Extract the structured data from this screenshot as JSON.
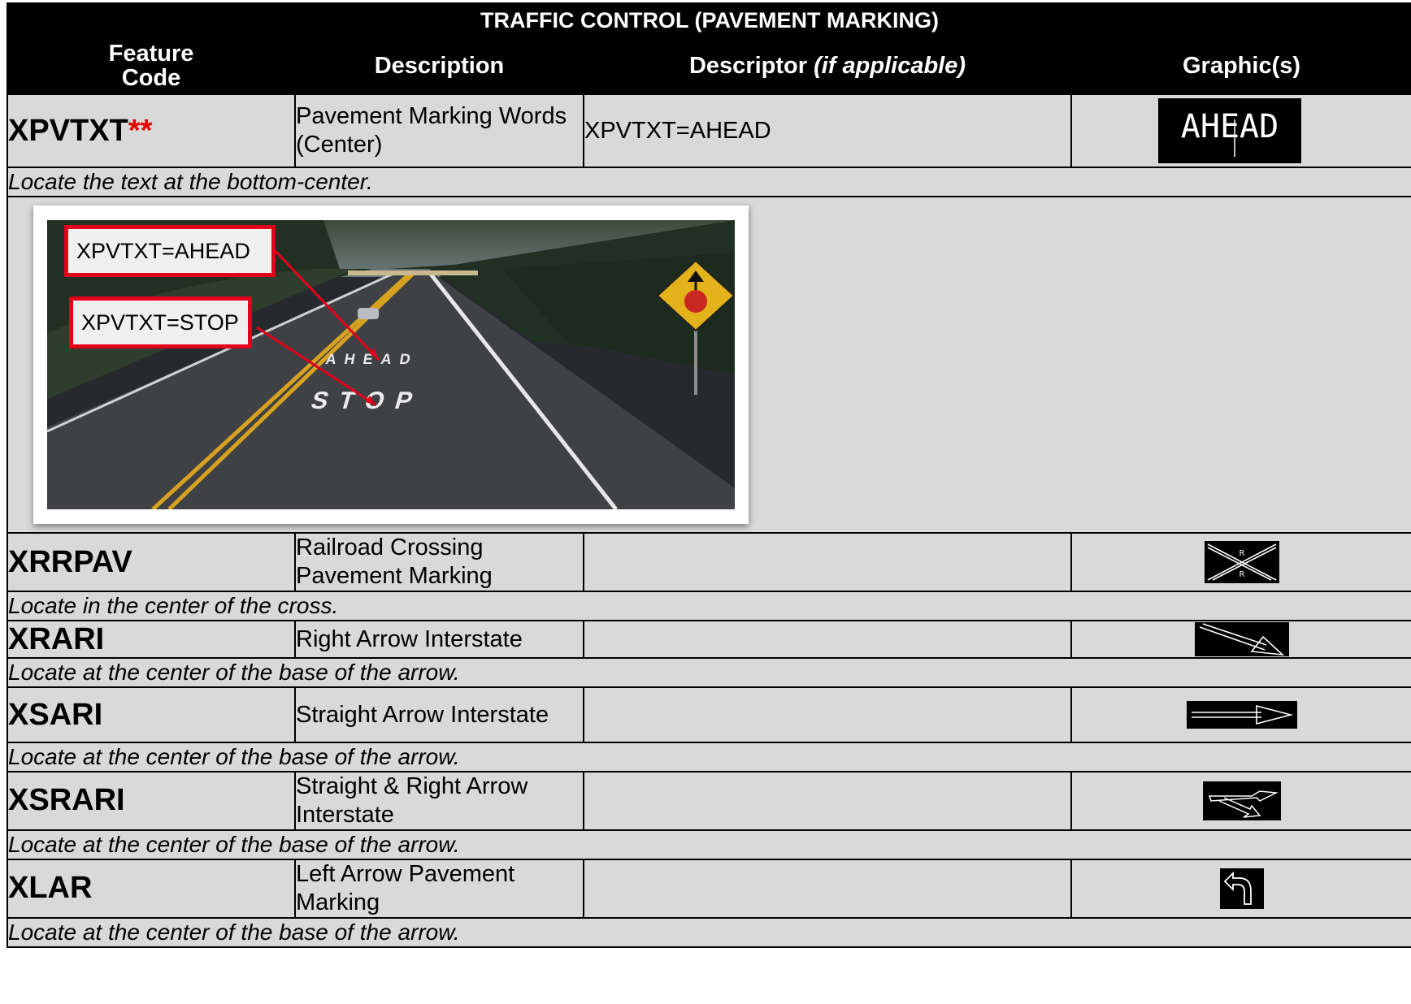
{
  "table": {
    "title": "TRAFFIC CONTROL (PAVEMENT MARKING)",
    "headers": {
      "feature_code": "Feature Code",
      "description": "Description",
      "descriptor": "Descriptor",
      "descriptor_suffix": "(if applicable)",
      "graphics": "Graphic(s)"
    },
    "rows": [
      {
        "code": "XPVTXT",
        "code_suffix": "**",
        "description": "Pavement Marking Words (Center)",
        "descriptor": "XPVTXT=AHEAD",
        "graphic_icon": "ahead-text-graphic",
        "graphic_text": "AHEAD",
        "note": "Locate the text at the bottom-center."
      },
      {
        "code": "XRRPAV",
        "description": "Railroad Crossing Pavement Marking",
        "descriptor": "",
        "graphic_icon": "railroad-crossing-graphic",
        "note": "Locate in the center of the cross."
      },
      {
        "code": "XRARI",
        "description": "Right Arrow Interstate",
        "descriptor": "",
        "graphic_icon": "right-arrow-graphic",
        "note": "Locate at the center of the base of the arrow."
      },
      {
        "code": "XSARI",
        "description": "Straight Arrow Interstate",
        "descriptor": "",
        "graphic_icon": "straight-arrow-graphic",
        "note": "Locate at the center of the base of the arrow."
      },
      {
        "code": "XSRARI",
        "description": "Straight & Right Arrow Interstate",
        "descriptor": "",
        "graphic_icon": "straight-right-arrow-graphic",
        "note": "Locate at the center of the base of the arrow."
      },
      {
        "code": "XLAR",
        "description": "Left Arrow Pavement Marking",
        "descriptor": "",
        "graphic_icon": "left-turn-arrow-graphic",
        "note": "Locate at the center of the base of the arrow."
      }
    ]
  },
  "photo": {
    "callouts": [
      "XPVTXT=AHEAD",
      "XPVTXT=STOP"
    ],
    "pavement_words": [
      "AHEAD",
      "STOP"
    ]
  },
  "colors": {
    "header_bg": "#000000",
    "row_bg": "#d9d9d9",
    "callout_border": "#e3001b",
    "stars": "#e60000"
  }
}
